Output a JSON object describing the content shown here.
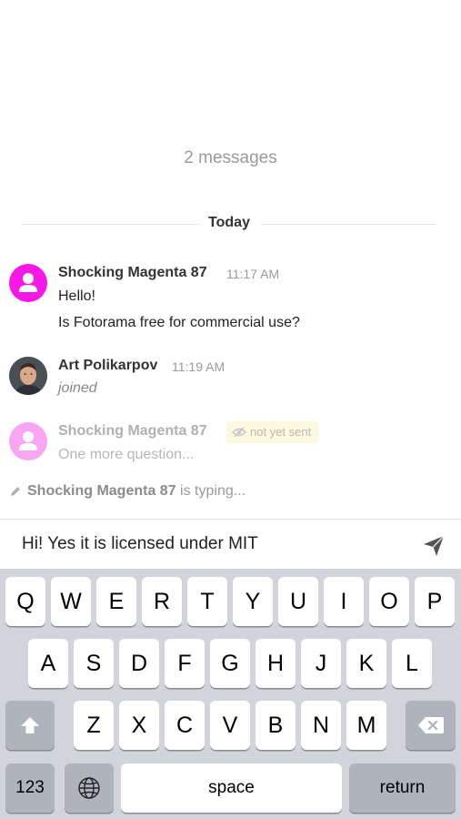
{
  "chat": {
    "message_count": "2 messages",
    "divider_label": "Today",
    "messages": [
      {
        "author": "Shocking Magenta 87",
        "time": "11:17 AM",
        "lines": [
          "Hello!",
          "Is Fotorama free for commercial use?"
        ]
      },
      {
        "author": "Art Polikarpov",
        "time": "11:19 AM",
        "lines": [
          "joined"
        ]
      },
      {
        "author": "Shocking Magenta 87",
        "status": "not yet sent",
        "lines": [
          "One more question..."
        ]
      }
    ],
    "typing": {
      "user": "Shocking Magenta 87",
      "suffix": "is typing..."
    }
  },
  "composer": {
    "value": "Hi! Yes it is licensed under MIT"
  },
  "keyboard": {
    "row1": [
      "Q",
      "W",
      "E",
      "R",
      "T",
      "Y",
      "U",
      "I",
      "O",
      "P"
    ],
    "row2": [
      "A",
      "S",
      "D",
      "F",
      "G",
      "H",
      "J",
      "K",
      "L"
    ],
    "row3": [
      "Z",
      "X",
      "C",
      "V",
      "B",
      "N",
      "M"
    ],
    "numbers_key": "123",
    "space_key": "space",
    "return_key": "return"
  },
  "colors": {
    "magenta_avatar": "#f518e6",
    "faded_avatar": "#f9a6f2",
    "badge_bg": "#fdf8de",
    "keyboard_bg": "#d1d5db"
  },
  "icons": [
    "user-icon",
    "eye-slash-icon",
    "pencil-icon",
    "send-icon",
    "globe-icon",
    "shift-icon",
    "backspace-icon"
  ]
}
